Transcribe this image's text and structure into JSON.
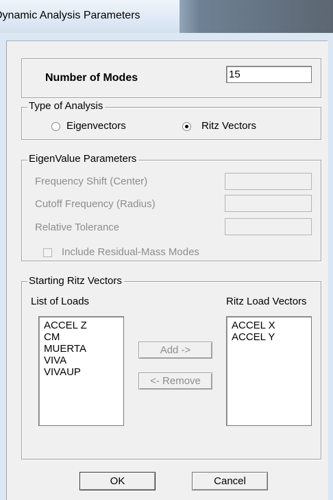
{
  "window": {
    "title": "Dynamic Analysis Parameters"
  },
  "number_of_modes": {
    "label": "Number of Modes",
    "value": "15"
  },
  "type_of_analysis": {
    "legend": "Type of Analysis",
    "options": [
      "Eigenvectors",
      "Ritz Vectors"
    ],
    "selected": "Ritz Vectors"
  },
  "eigenvalue_parameters": {
    "legend": "EigenValue Parameters",
    "frequency_shift_label": "Frequency Shift  (Center)",
    "cutoff_frequency_label": "Cutoff Frequency  (Radius)",
    "relative_tolerance_label": "Relative Tolerance",
    "residual_mass_label": "Include Residual-Mass Modes",
    "frequency_shift_value": "",
    "cutoff_frequency_value": "",
    "relative_tolerance_value": ""
  },
  "starting_ritz_vectors": {
    "legend": "Starting Ritz Vectors",
    "list_of_loads_label": "List of Loads",
    "ritz_load_vectors_label": "Ritz Load Vectors",
    "list_of_loads": [
      "ACCEL Z",
      "CM",
      "MUERTA",
      "VIVA",
      "VIVAUP"
    ],
    "ritz_load_vectors": [
      "ACCEL X",
      "ACCEL Y"
    ],
    "add_label": "Add ->",
    "remove_label": "<- Remove"
  },
  "buttons": {
    "ok": "OK",
    "cancel": "Cancel"
  }
}
